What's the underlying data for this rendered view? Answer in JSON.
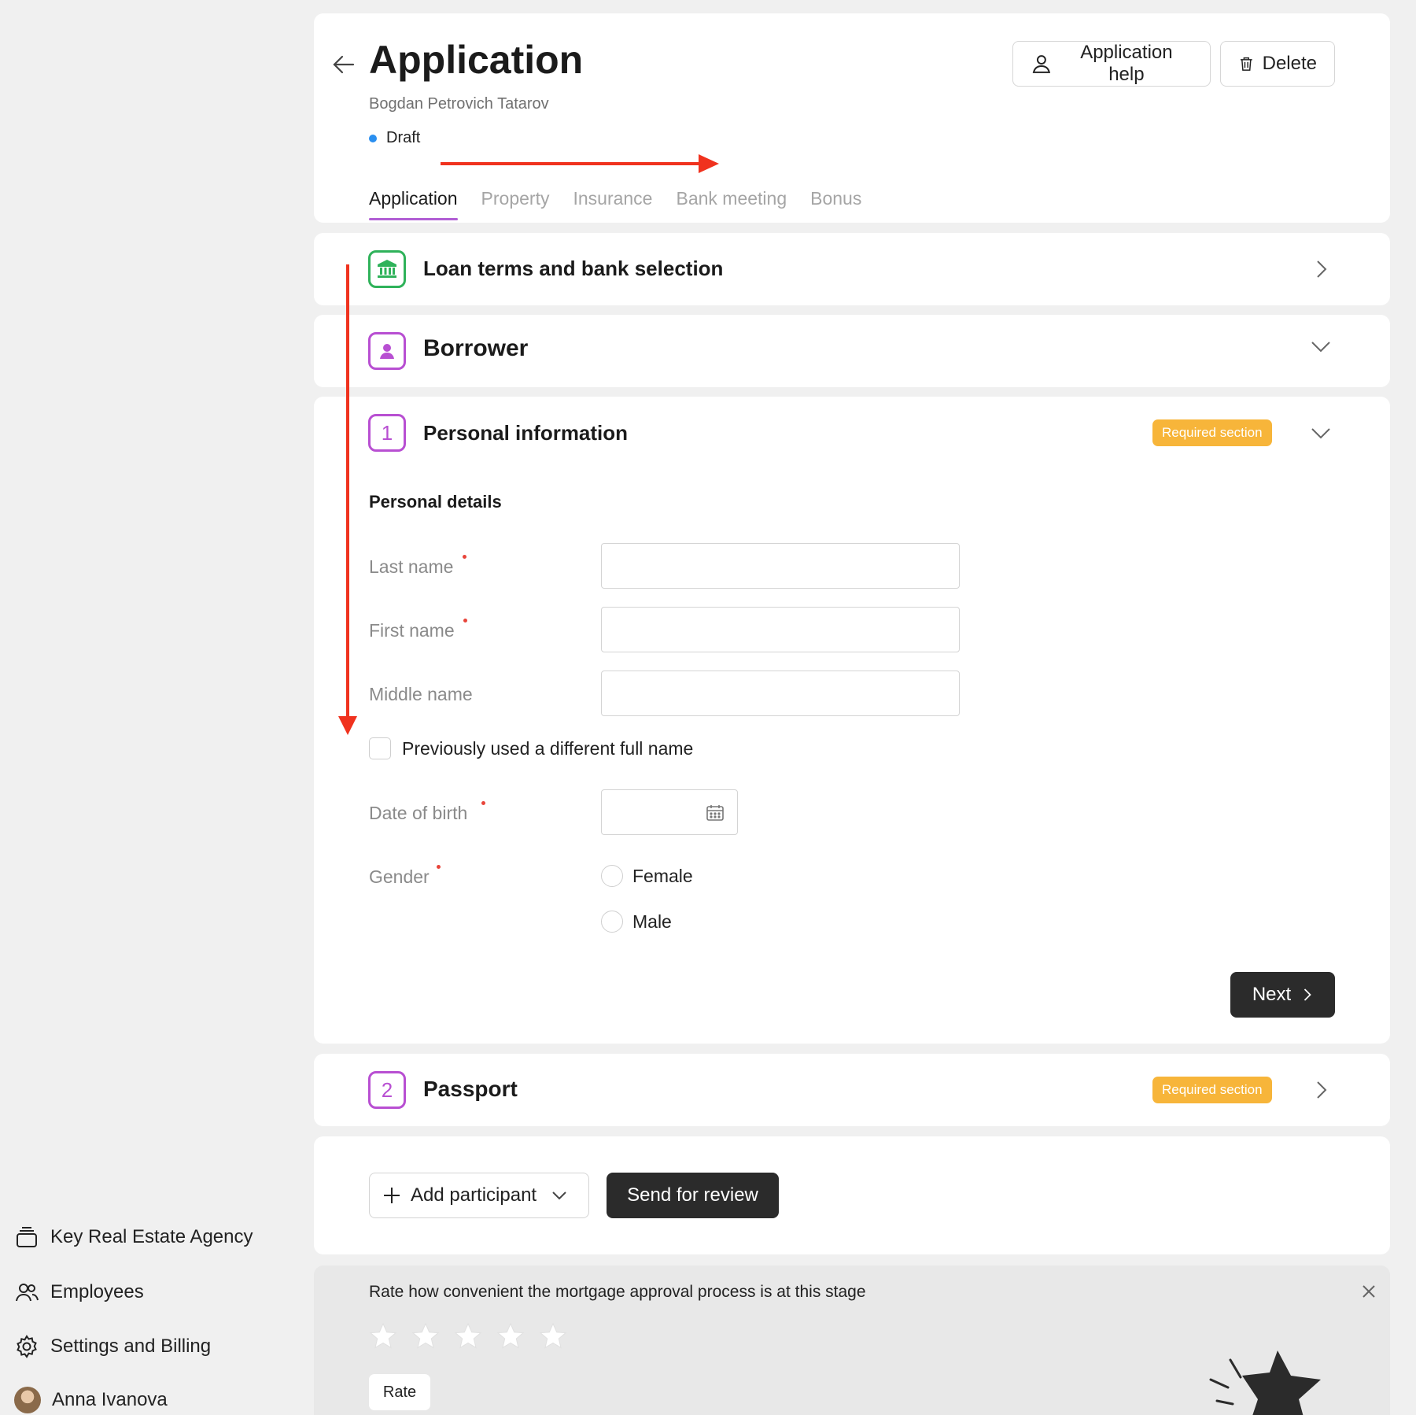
{
  "sidebar": {
    "items": [
      {
        "label": "Key Real Estate Agency",
        "icon": "office-icon"
      },
      {
        "label": "Employees",
        "icon": "users-icon"
      },
      {
        "label": "Settings and Billing",
        "icon": "gear-icon"
      },
      {
        "label": "Anna Ivanova",
        "icon": "avatar"
      }
    ]
  },
  "header": {
    "title": "Application",
    "subtitle": "Bogdan Petrovich Tatarov",
    "status": "Draft",
    "status_color": "#2a8ff0",
    "help_label": "Application help",
    "delete_label": "Delete",
    "tabs": [
      {
        "label": "Application",
        "active": true
      },
      {
        "label": "Property"
      },
      {
        "label": "Insurance"
      },
      {
        "label": "Bank meeting"
      },
      {
        "label": "Bonus"
      }
    ],
    "accent": "#b15ed4"
  },
  "sections": {
    "loan": {
      "title": "Loan terms and bank selection",
      "icon": "bank-icon",
      "color": "#2fb25a"
    },
    "borrower": {
      "title": "Borrower",
      "icon": "person-icon",
      "color": "#b84fd2"
    },
    "personal": {
      "number": "1",
      "title": "Personal information",
      "badge": "Required section",
      "subheading": "Personal details",
      "fields": {
        "last_name": {
          "label": "Last name",
          "value": ""
        },
        "first_name": {
          "label": "First name",
          "value": ""
        },
        "middle_name": {
          "label": "Middle name",
          "value": ""
        }
      },
      "different_name_label": "Previously used a different full name",
      "date_of_birth_label": "Date of birth",
      "gender_label": "Gender",
      "gender_options": [
        "Female",
        "Male"
      ],
      "next_label": "Next"
    },
    "passport": {
      "number": "2",
      "title": "Passport",
      "badge": "Required section"
    }
  },
  "actions": {
    "add_participant": "Add participant",
    "send_for_review": "Send for review"
  },
  "rating": {
    "prompt": "Rate how convenient the mortgage approval process is at this stage",
    "stars": 5,
    "rate_label": "Rate"
  },
  "colors": {
    "badge": "#f7b53a",
    "annotation_arrow": "#f0321e",
    "dark_button": "#2b2b2b"
  }
}
